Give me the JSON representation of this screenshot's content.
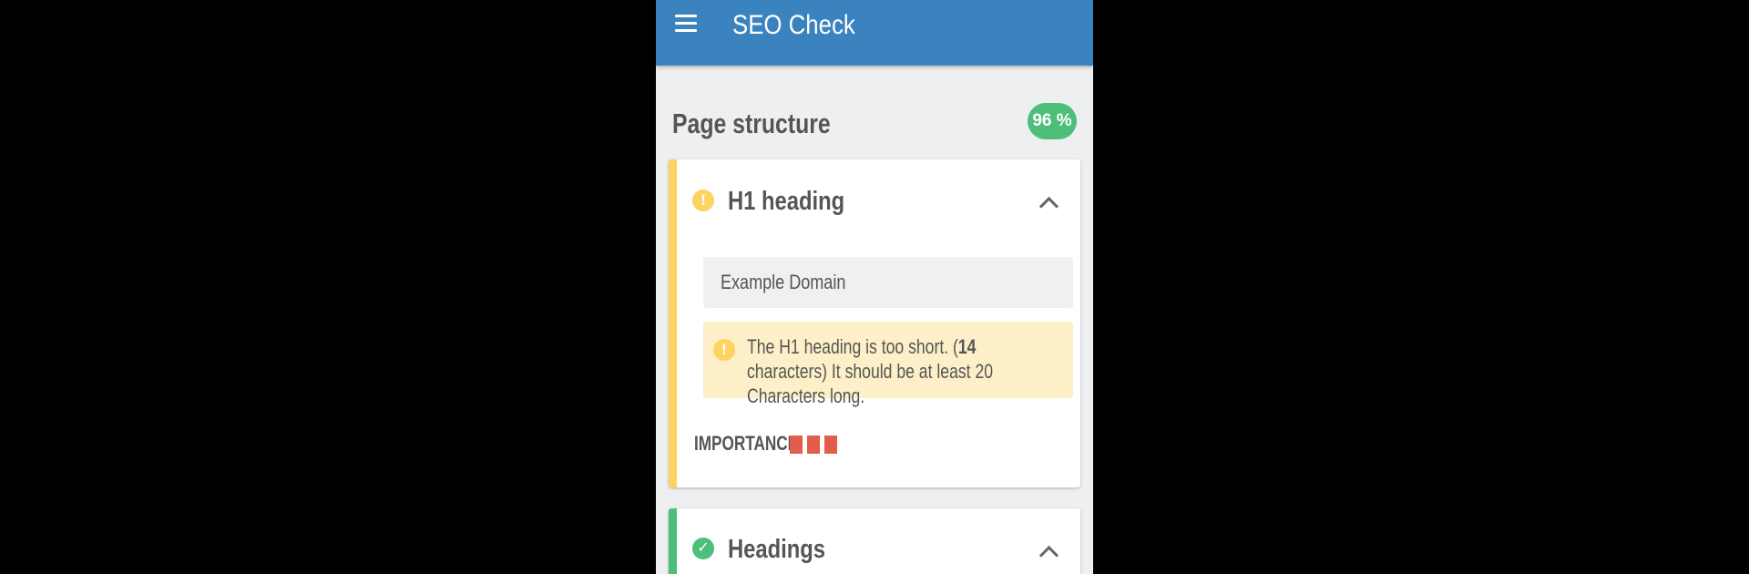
{
  "app_bar": {
    "menu_icon": "hamburger-menu-icon",
    "title": "SEO Check"
  },
  "section": {
    "title": "Page structure",
    "score": "96 %",
    "score_color": "#4dbf7a"
  },
  "cards": [
    {
      "status": "warning",
      "status_icon": "!",
      "title": "H1 heading",
      "expanded": true,
      "value": "Example Domain",
      "message": {
        "icon": "!",
        "before": "The H1 heading is too short. (",
        "count": "14",
        "after": " characters) It should be at least 20 Characters long."
      },
      "importance_label": "IMPORTANCE",
      "importance_level": 3
    },
    {
      "status": "ok",
      "status_icon": "✓",
      "title": "Headings",
      "expanded": true
    }
  ],
  "colors": {
    "app_bar": "#3b83bf",
    "warning": "#fdd361",
    "success": "#4dbf7a",
    "importance": "#e35d4d",
    "background": "#eeeff1"
  }
}
